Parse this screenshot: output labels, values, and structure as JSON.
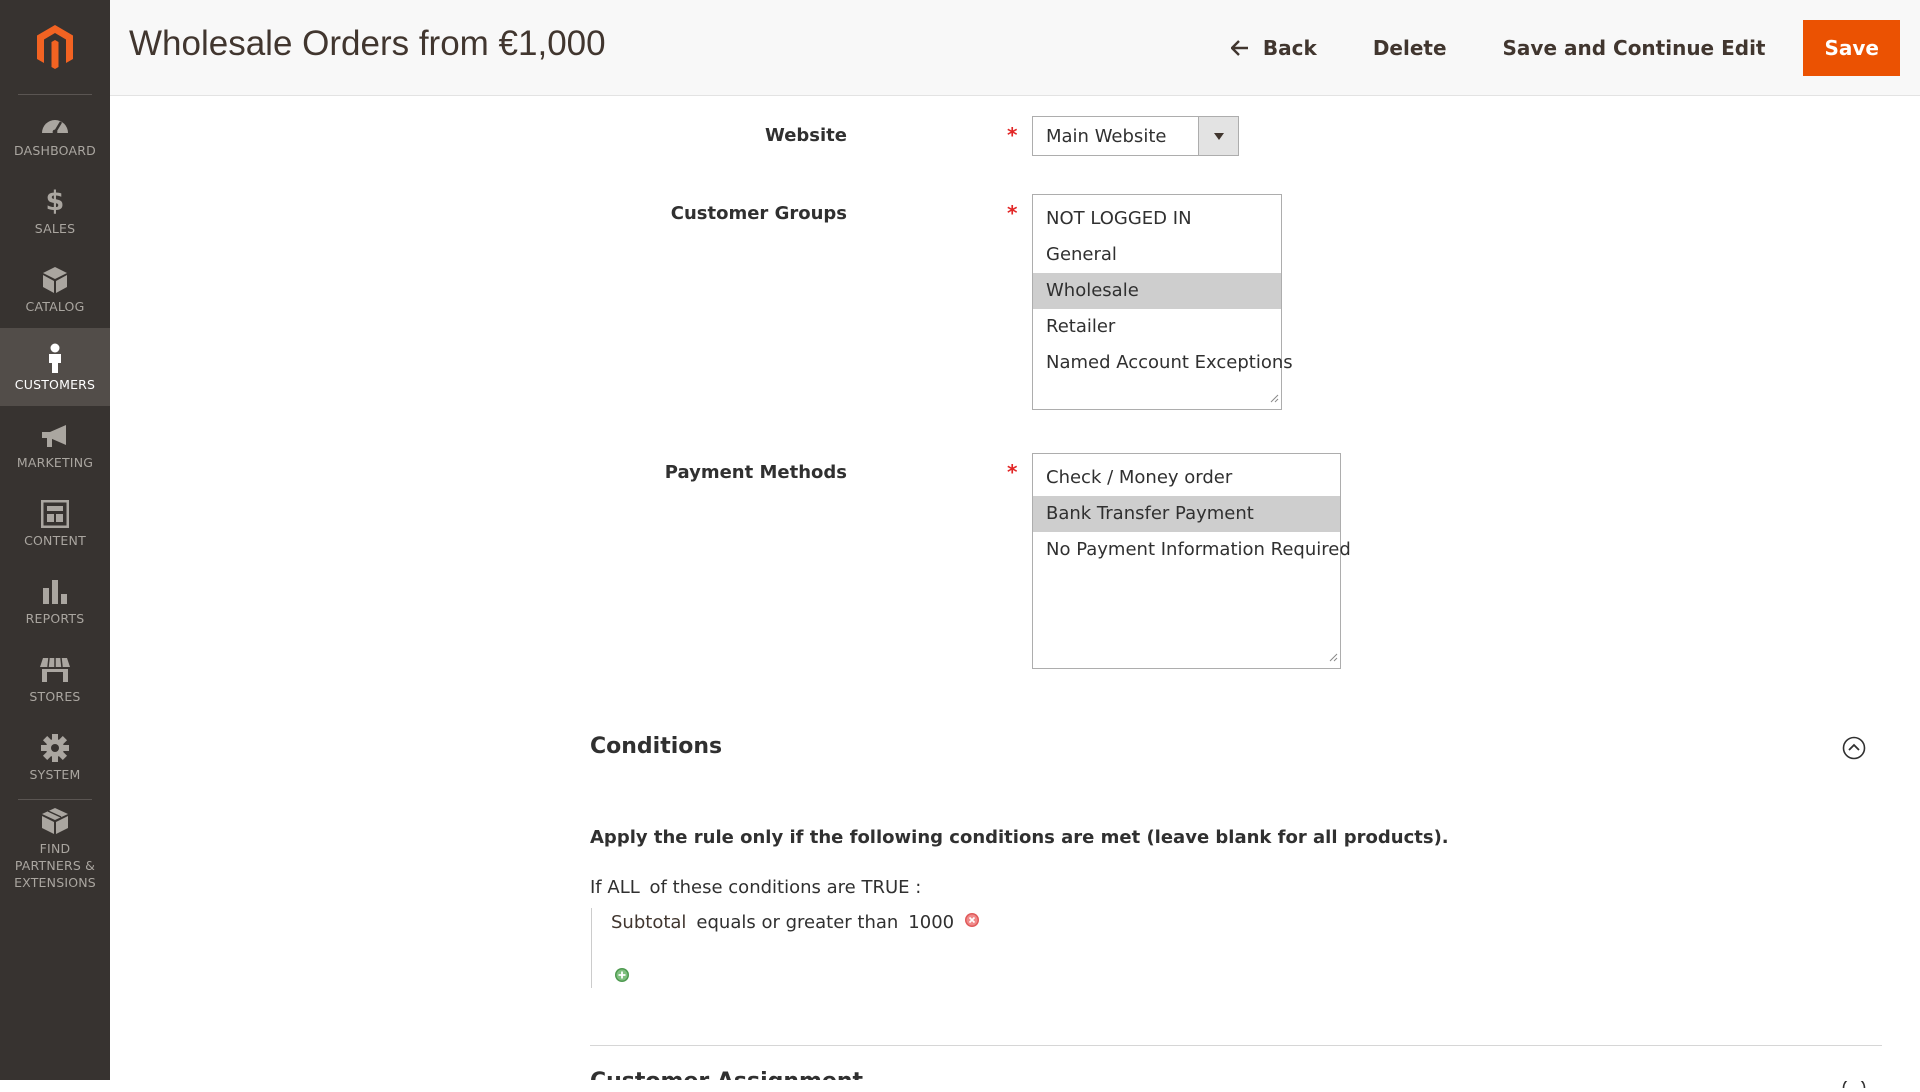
{
  "sidebar": {
    "items": [
      {
        "label": "DASHBOARD",
        "icon": "dashboard-icon"
      },
      {
        "label": "SALES",
        "icon": "dollar-icon"
      },
      {
        "label": "CATALOG",
        "icon": "box-icon"
      },
      {
        "label": "CUSTOMERS",
        "icon": "person-icon",
        "active": true
      },
      {
        "label": "MARKETING",
        "icon": "megaphone-icon"
      },
      {
        "label": "CONTENT",
        "icon": "layout-icon"
      },
      {
        "label": "REPORTS",
        "icon": "bar-chart-icon"
      },
      {
        "label": "STORES",
        "icon": "storefront-icon"
      },
      {
        "label": "SYSTEM",
        "icon": "gear-icon"
      },
      {
        "label": "FIND PARTNERS & EXTENSIONS",
        "icon": "extensions-icon"
      }
    ]
  },
  "header": {
    "title": "Wholesale Orders from €1,000",
    "back_label": "Back",
    "delete_label": "Delete",
    "save_continue_label": "Save and Continue Edit",
    "save_label": "Save"
  },
  "form": {
    "website": {
      "label": "Website",
      "value": "Main Website"
    },
    "customer_groups": {
      "label": "Customer Groups",
      "options": [
        {
          "label": "NOT LOGGED IN",
          "selected": false
        },
        {
          "label": "General",
          "selected": false
        },
        {
          "label": "Wholesale",
          "selected": true
        },
        {
          "label": "Retailer",
          "selected": false
        },
        {
          "label": "Named Account Exceptions",
          "selected": false
        }
      ]
    },
    "payment_methods": {
      "label": "Payment Methods",
      "options": [
        {
          "label": "Check / Money order",
          "selected": false
        },
        {
          "label": "Bank Transfer Payment",
          "selected": true
        },
        {
          "label": "No Payment Information Required",
          "selected": false
        }
      ]
    },
    "required_mark": "*"
  },
  "conditions": {
    "title": "Conditions",
    "description": "Apply the rule only if the following conditions are met (leave blank for all products).",
    "tree": {
      "prefix": "If",
      "aggregator": "ALL",
      "middle": "of these conditions are",
      "value": "TRUE",
      "suffix": ":"
    },
    "rule": {
      "attribute": "Subtotal",
      "operator": "equals or greater than",
      "value": "1000"
    }
  },
  "next_section": {
    "title": "Customer Assignment"
  },
  "colors": {
    "accent": "#eb5202",
    "sidebar_bg": "#373330",
    "sidebar_active": "#524d49",
    "selected_option": "#cecece",
    "required": "#e22626"
  }
}
